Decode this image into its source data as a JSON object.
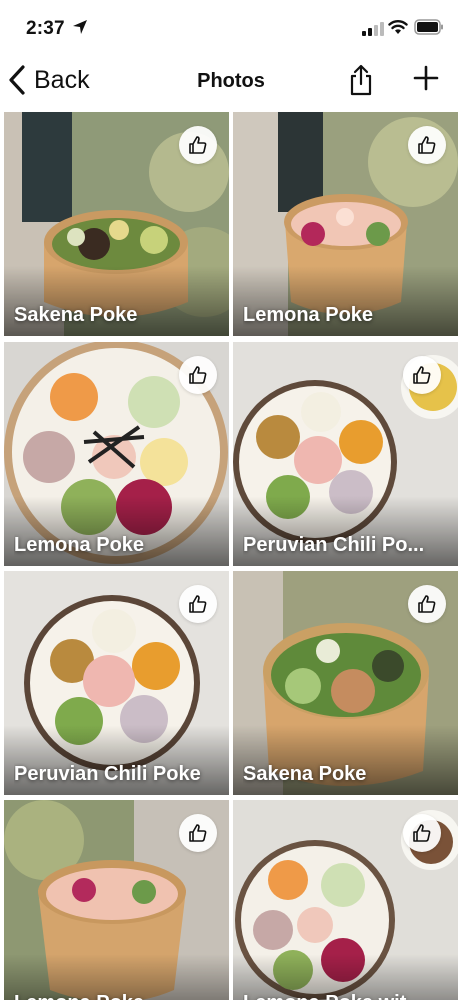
{
  "status_bar": {
    "time": "2:37"
  },
  "nav": {
    "back_label": "Back",
    "title": "Photos"
  },
  "photos": [
    {
      "caption": "Sakena Poke"
    },
    {
      "caption": "Lemona Poke"
    },
    {
      "caption": "Lemona Poke"
    },
    {
      "caption": "Peruvian Chili Po..."
    },
    {
      "caption": "Peruvian Chili Poke"
    },
    {
      "caption": "Sakena Poke"
    },
    {
      "caption": "Lemona Poke"
    },
    {
      "caption": "Lemona Poke wit..."
    }
  ],
  "icons": {
    "location": "location-arrow-icon",
    "signal": "cellular-signal-icon",
    "wifi": "wifi-icon",
    "battery": "battery-icon",
    "back": "chevron-left-icon",
    "share": "share-icon",
    "add": "plus-icon",
    "like": "thumbs-up-icon"
  },
  "colors": {
    "accent": "#111111",
    "caption": "#ffffff",
    "like_bg": "#ffffff"
  }
}
